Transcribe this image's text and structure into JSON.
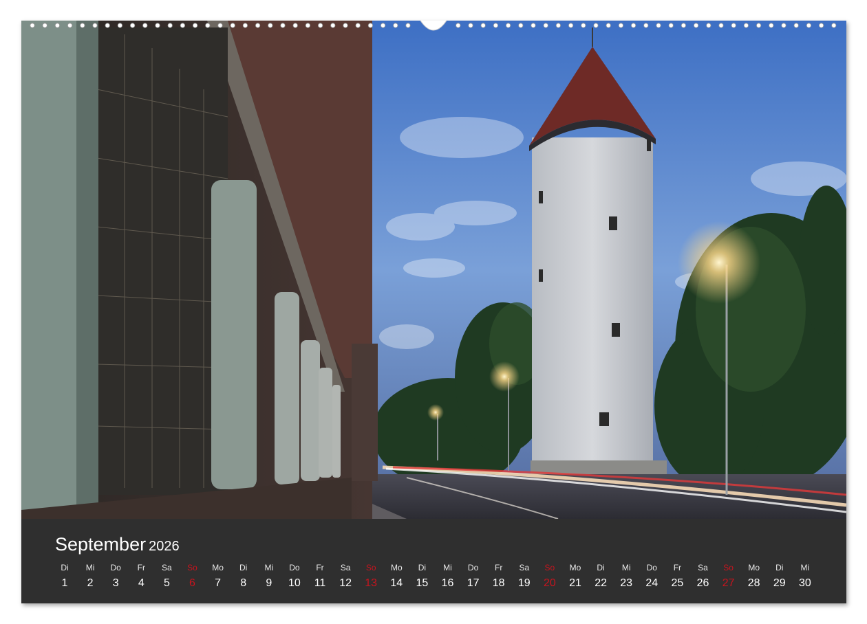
{
  "calendar": {
    "month": "September",
    "year": "2026",
    "sunday_color": "#c8141e",
    "days": [
      {
        "wd": "Di",
        "n": "1"
      },
      {
        "wd": "Mi",
        "n": "2"
      },
      {
        "wd": "Do",
        "n": "3"
      },
      {
        "wd": "Fr",
        "n": "4"
      },
      {
        "wd": "Sa",
        "n": "5"
      },
      {
        "wd": "So",
        "n": "6",
        "sun": true
      },
      {
        "wd": "Mo",
        "n": "7"
      },
      {
        "wd": "Di",
        "n": "8"
      },
      {
        "wd": "Mi",
        "n": "9"
      },
      {
        "wd": "Do",
        "n": "10"
      },
      {
        "wd": "Fr",
        "n": "11"
      },
      {
        "wd": "Sa",
        "n": "12"
      },
      {
        "wd": "So",
        "n": "13",
        "sun": true
      },
      {
        "wd": "Mo",
        "n": "14"
      },
      {
        "wd": "Di",
        "n": "15"
      },
      {
        "wd": "Mi",
        "n": "16"
      },
      {
        "wd": "Do",
        "n": "17"
      },
      {
        "wd": "Fr",
        "n": "18"
      },
      {
        "wd": "Sa",
        "n": "19"
      },
      {
        "wd": "So",
        "n": "20",
        "sun": true
      },
      {
        "wd": "Mo",
        "n": "21"
      },
      {
        "wd": "Di",
        "n": "22"
      },
      {
        "wd": "Mi",
        "n": "23"
      },
      {
        "wd": "Do",
        "n": "24"
      },
      {
        "wd": "Fr",
        "n": "25"
      },
      {
        "wd": "Sa",
        "n": "26"
      },
      {
        "wd": "So",
        "n": "27",
        "sun": true
      },
      {
        "wd": "Mo",
        "n": "28"
      },
      {
        "wd": "Di",
        "n": "29"
      },
      {
        "wd": "Mi",
        "n": "30"
      }
    ]
  }
}
